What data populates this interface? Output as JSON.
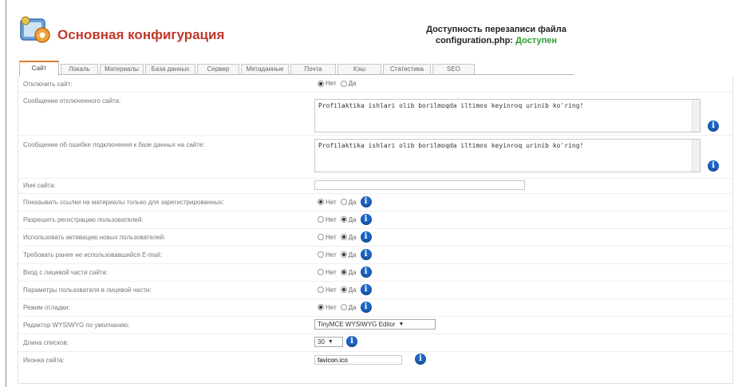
{
  "header": {
    "title": "Основная конфигурация",
    "availability_line1": "Доступность перезаписи файла",
    "availability_file": "configuration.php:",
    "availability_status": "Доступен",
    "status_color": "#2e9c2e",
    "title_color": "#c0392b"
  },
  "tabs": [
    {
      "label": "Сайт",
      "active": true
    },
    {
      "label": "Локаль",
      "active": false
    },
    {
      "label": "Материалы",
      "active": false
    },
    {
      "label": "База данных",
      "active": false
    },
    {
      "label": "Сервер",
      "active": false
    },
    {
      "label": "Метаданные",
      "active": false
    },
    {
      "label": "Почта",
      "active": false
    },
    {
      "label": "Кэш",
      "active": false
    },
    {
      "label": "Статистика",
      "active": false
    },
    {
      "label": "SEO",
      "active": false
    }
  ],
  "radio": {
    "no": "Нет",
    "yes": "Да"
  },
  "info_glyph": "i",
  "rows": {
    "offline": {
      "label": "Отключить сайт:",
      "value": "no"
    },
    "offline_msg": {
      "label": "Сообщение отключенного сайта:",
      "value": "Profilaktika ishlari olib borilmoqda iltimos keyinroq urinib ko'ring!"
    },
    "db_error_msg": {
      "label": "Сообщение об ошибке подключения к базе данных на сайте:",
      "value": "Profilaktika ishlari olib borilmoqda iltimos keyinroq urinib ko'ring!"
    },
    "site_name": {
      "label": "Имя сайта:",
      "value": ""
    },
    "reg_links": {
      "label": "Показывать ссылки на материалы только для зарегистрированных:",
      "value": "no"
    },
    "allow_reg": {
      "label": "Разрешить регистрацию пользователей:",
      "value": "yes"
    },
    "activation": {
      "label": "Использовать активацию новых пользователей:",
      "value": "yes"
    },
    "unique_email": {
      "label": "Требовать ранее не использовавшийся E-mail:",
      "value": "yes"
    },
    "frontend_login": {
      "label": "Вход с лицевой части сайта:",
      "value": "yes"
    },
    "user_params": {
      "label": "Параметры пользователя в лицевой части:",
      "value": "yes"
    },
    "debug": {
      "label": "Режим отладки:",
      "value": "no"
    },
    "editor": {
      "label": "Редактор WYSIWYG по умолчанию:",
      "value": "TinyMCE WYSIWYG Editor"
    },
    "list_length": {
      "label": "Длина списков:",
      "value": "30"
    },
    "favicon": {
      "label": "Иконка сайта:",
      "value": "favicon.ico"
    }
  }
}
